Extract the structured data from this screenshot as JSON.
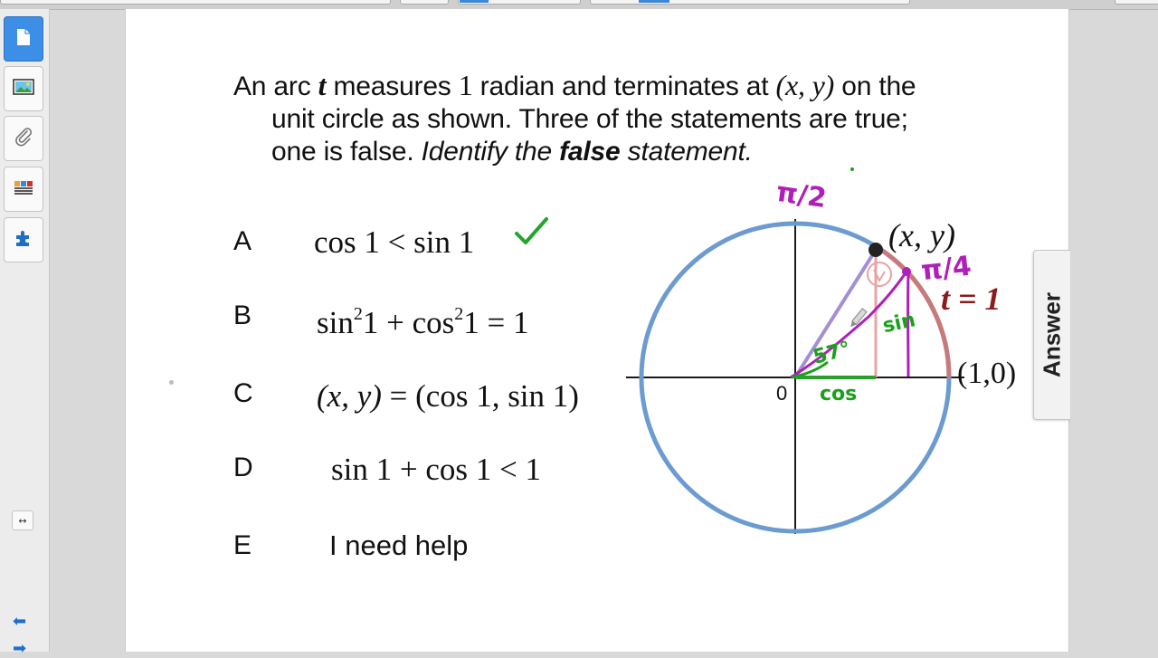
{
  "question": {
    "part1": "An arc ",
    "var_t": "t",
    "part2": " measures ",
    "one": "1",
    "part3": " radian and terminates at ",
    "point": "(x, y)",
    "part4": " on the",
    "line2": "unit circle as shown. Three of the statements are true;",
    "line3a": "one is false. ",
    "line3b": "Identify the ",
    "line3c": "false",
    "line3d": " statement."
  },
  "options": [
    {
      "letter": "A",
      "expr": "cos 1 < sin 1"
    },
    {
      "letter": "B",
      "expr_sin": "sin",
      "expr_sup1": "2",
      "expr_mid": "1 + cos",
      "expr_sup2": "2",
      "expr_end": "1 = 1"
    },
    {
      "letter": "C",
      "expr_lhs": "(x, y)",
      "expr_rhs": " = (cos 1, sin 1)"
    },
    {
      "letter": "D",
      "expr": "sin 1 + cos 1 < 1"
    },
    {
      "letter": "E",
      "expr": "I need help"
    }
  ],
  "answer_tab": "Answer",
  "diagram": {
    "point_label": "(x, y)",
    "t_label": "t = 1",
    "one_zero_label": "(1,0)",
    "origin_label": "0",
    "annotations": {
      "pi_half": "π/2",
      "pi_quarter": "π/4",
      "degrees": "57°",
      "sin": "sin",
      "cos": "cos"
    }
  },
  "sidebar": {
    "icons": [
      "page-icon",
      "image-icon",
      "attachment-icon",
      "gallery-icon",
      "addons-icon"
    ],
    "collapse": "↔",
    "prev": "⬅",
    "next": "➡"
  },
  "colors": {
    "circle": "#6b9bd1",
    "handwriting_purple": "#b01fb8",
    "handwriting_green": "#19a11a",
    "t_label": "#8b1b1b",
    "triangle_pink": "#e8a3a3",
    "checkmark": "#22a52a"
  }
}
